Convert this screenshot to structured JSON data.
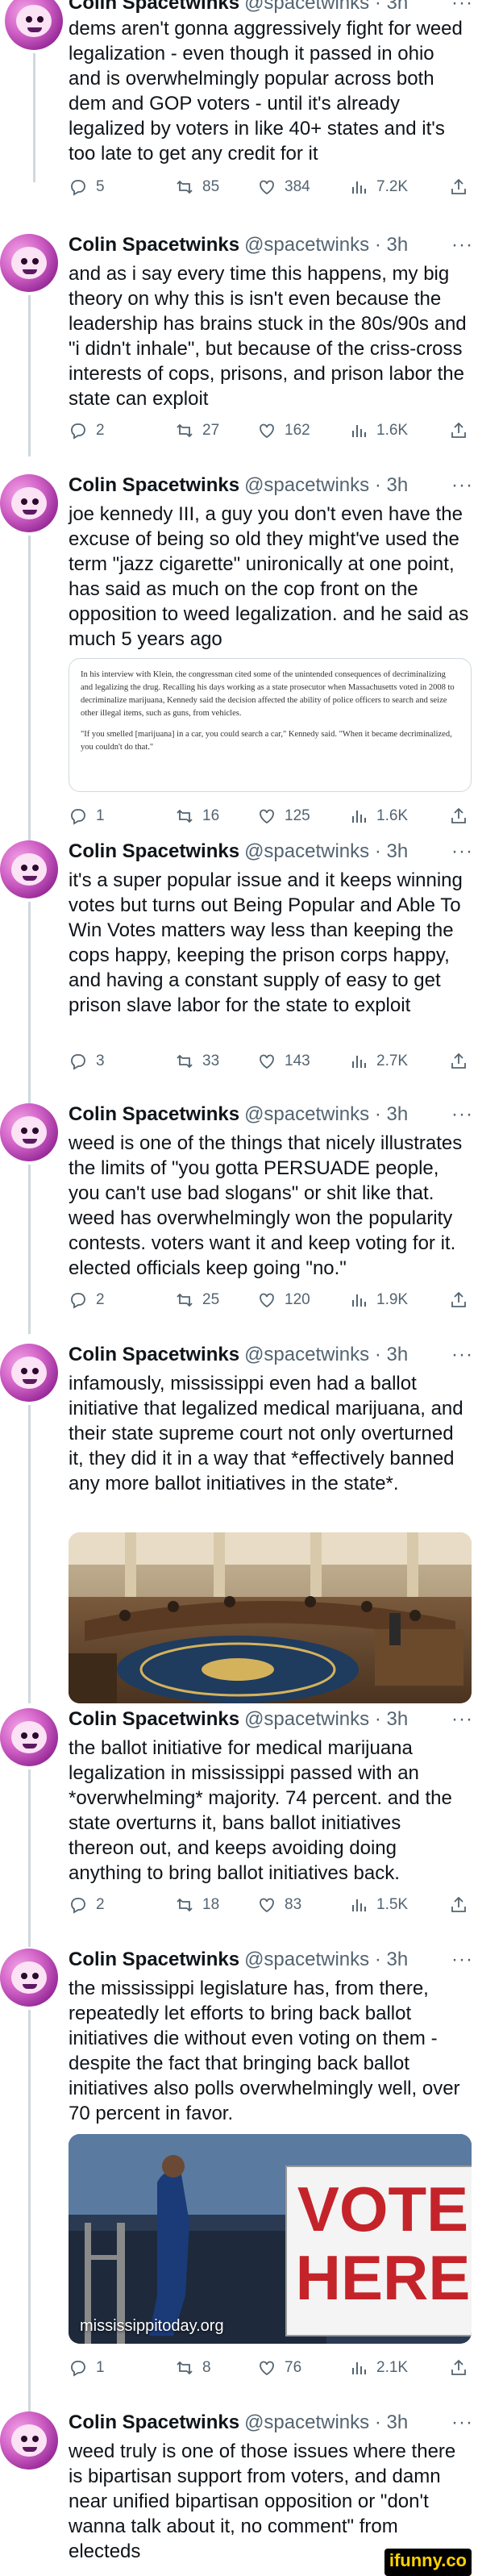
{
  "author": {
    "name": "Colin Spacetwinks",
    "handle": "@spacetwinks",
    "time": "3h"
  },
  "more_label": "···",
  "separator": "·",
  "tweets": [
    {
      "text": "dems aren't gonna aggressively fight for weed legalization - even though it passed in ohio and is overwhelmingly popular across both dem and GOP voters - until it's already legalized by voters in like 40+ states and it's too late to get any credit for it",
      "replies": "5",
      "retweets": "85",
      "likes": "384",
      "views": "7.2K"
    },
    {
      "text": "and as i say every time this happens, my big theory on why this is isn't even because the leadership has brains stuck in the 80s/90s and \"i didn't inhale\", but because of the criss-cross interests of cops, prisons, and prison labor the state can exploit",
      "replies": "2",
      "retweets": "27",
      "likes": "162",
      "views": "1.6K"
    },
    {
      "text": "joe kennedy III, a guy you don't even have the excuse of being so old they might've used the term \"jazz cigarette\" unironically at one point, has said as much on the cop front on the opposition to weed legalization. and he said as much 5 years ago",
      "quote_p1": "In his interview with Klein, the congressman cited some of the unintended consequences of decriminalizing and legalizing the drug. Recalling his days working as a state prosecutor when Massachusetts voted in 2008 to decriminalize marijuana, Kennedy said the decision affected the ability of police officers to search and seize other illegal items, such as guns, from vehicles.",
      "quote_p2": "\"If you smelled [marijuana] in a car, you could search a car,\" Kennedy said. \"When it became decriminalized, you couldn't do that.\"",
      "replies": "1",
      "retweets": "16",
      "likes": "125",
      "views": "1.6K"
    },
    {
      "text": "it's a super popular issue and it keeps winning votes but turns out Being Popular and Able To Win Votes matters way less than keeping the cops happy, keeping the prison corps happy, and having a constant supply of easy to get prison slave labor for the state to exploit",
      "replies": "3",
      "retweets": "33",
      "likes": "143",
      "views": "2.7K"
    },
    {
      "text": "weed is one of the things that nicely illustrates the limits of \"you gotta PERSUADE people, you can't use bad slogans\" or shit like that. weed has overwhelmingly won the popularity contests. voters want it and keep voting for it. elected officials keep going \"no.\"",
      "replies": "2",
      "retweets": "25",
      "likes": "120",
      "views": "1.9K"
    },
    {
      "text": "infamously, mississippi even had a ballot initiative that legalized medical marijuana, and their state supreme court not only overturned it, they did it in a way that *effectively banned any more ballot initiatives in the state*."
    },
    {
      "text": "the ballot initiative for medical marijuana legalization in mississippi passed with an *overwhelming* majority. 74 percent. and the state overturns it, bans ballot initiatives thereon out, and keeps avoiding doing anything to bring ballot initiatives back.",
      "replies": "2",
      "retweets": "18",
      "likes": "83",
      "views": "1.5K"
    },
    {
      "text": "the mississippi legislature has, from there, repeatedly let efforts to bring back ballot initiatives die without even voting on them - despite the fact that bringing back ballot initiatives also polls overwhelmingly well, over 70 percent in favor.",
      "sign_line1": "VOTE",
      "sign_line2": "HERE",
      "watermark": "mississippitoday.org",
      "replies": "1",
      "retweets": "8",
      "likes": "76",
      "views": "2.1K"
    },
    {
      "text": "weed truly is one of those issues where there is bipartisan support from voters, and damn near unified bipartisan opposition or \"don't wanna talk about it, no comment\" from electeds"
    }
  ],
  "footer_watermark": "ifunny.co"
}
